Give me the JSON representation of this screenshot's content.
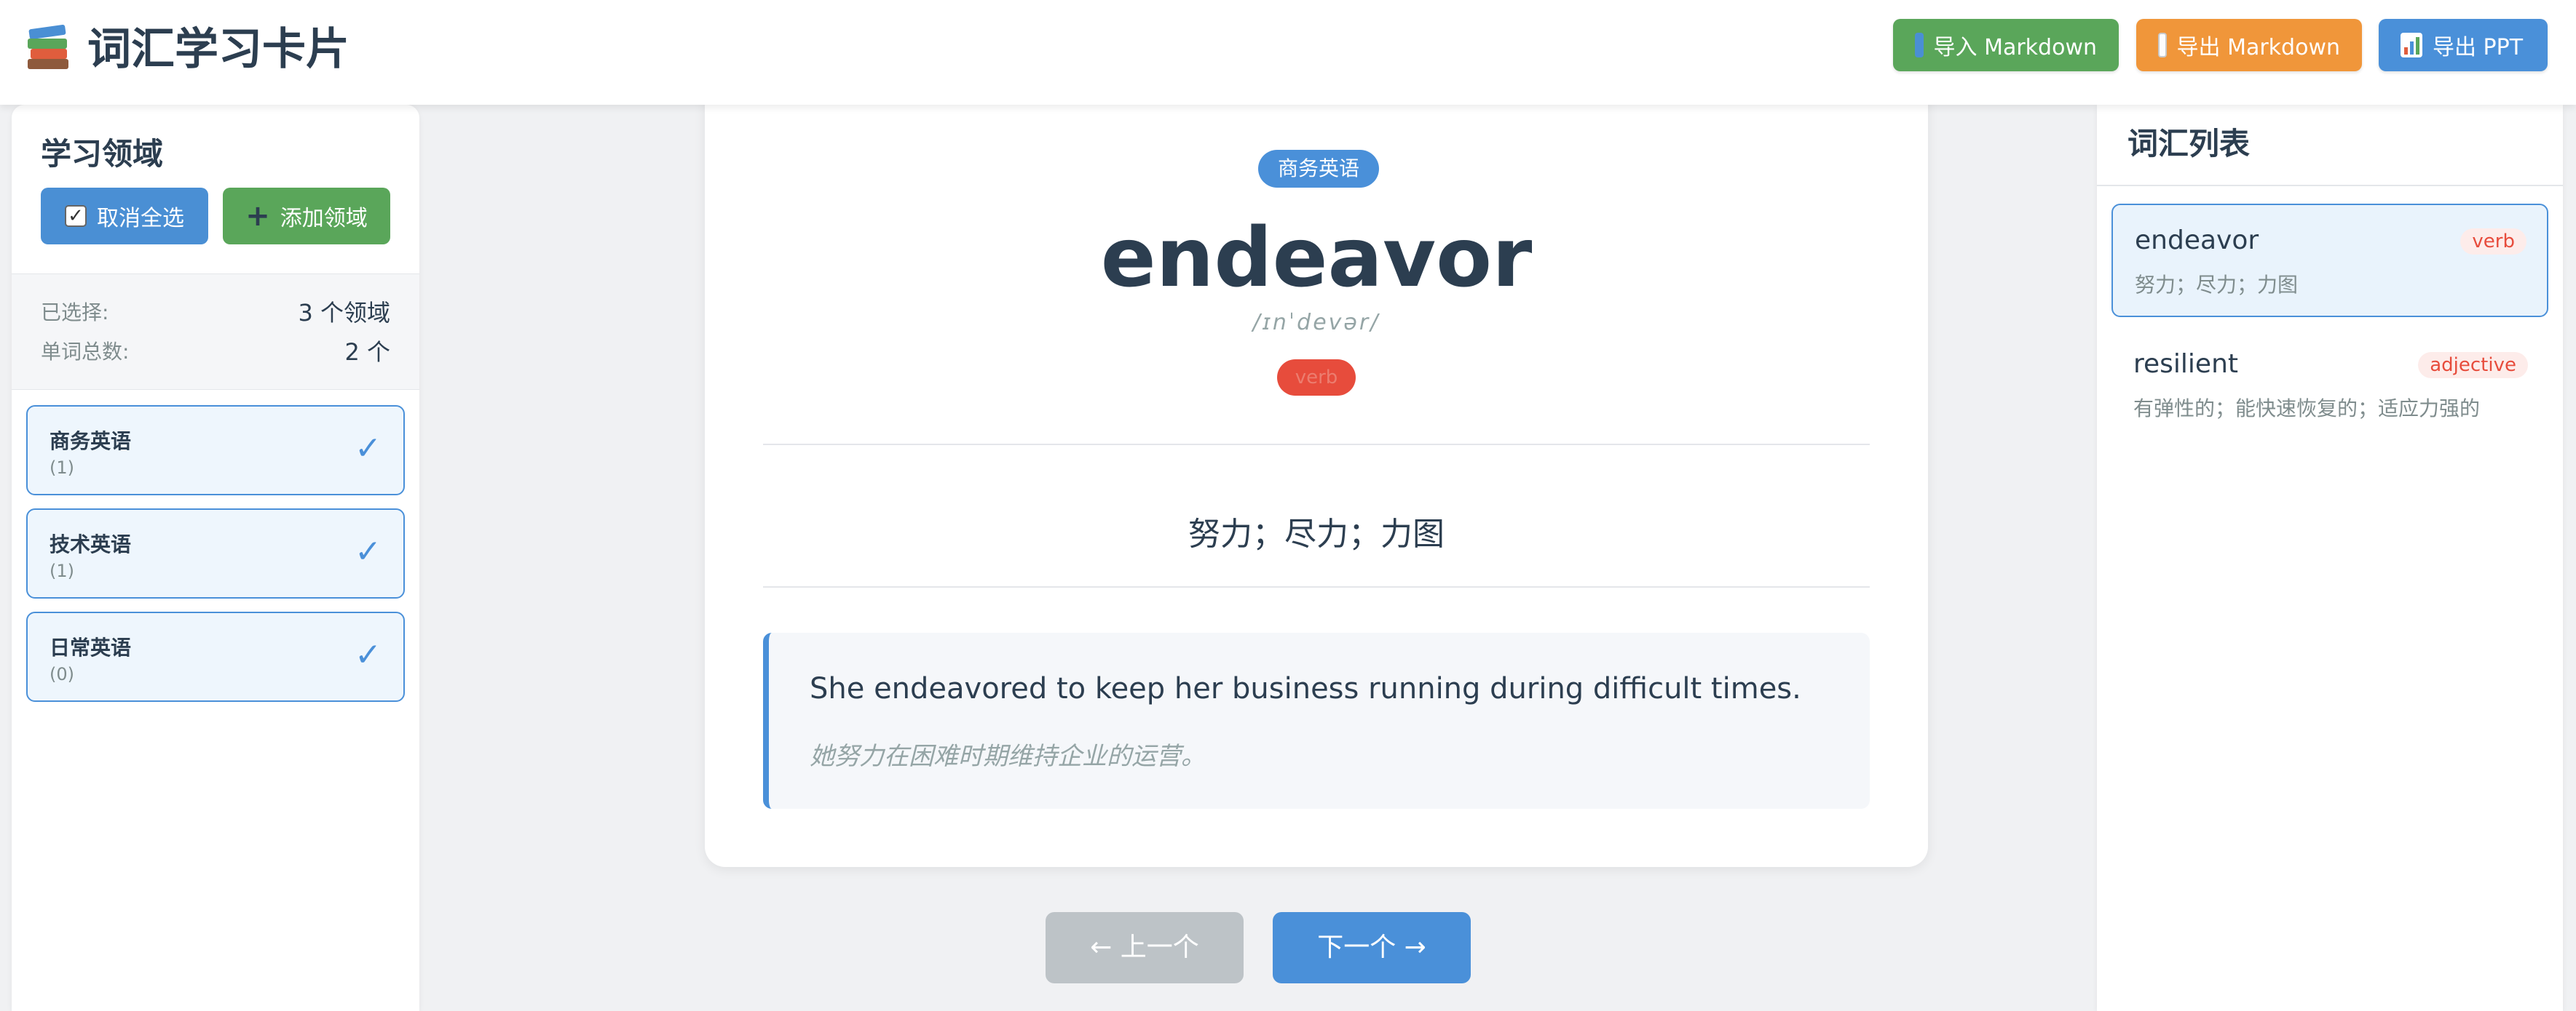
{
  "header": {
    "title": "词汇学习卡片",
    "logo_icon": "books-icon",
    "buttons": {
      "import_label": "导入 Markdown",
      "export_md_label": "导出 Markdown",
      "export_ppt_label": "导出 PPT"
    }
  },
  "sidebar": {
    "title": "学习领域",
    "deselect_label": "取消全选",
    "add_domain_label": "添加领域",
    "stats": {
      "selected_key": "已选择:",
      "selected_value": "3 个领域",
      "total_key": "单词总数:",
      "total_value": "2 个"
    },
    "domains": [
      {
        "name": "商务英语",
        "count": "(1)",
        "checked": true
      },
      {
        "name": "技术英语",
        "count": "(1)",
        "checked": true
      },
      {
        "name": "日常英语",
        "count": "(0)",
        "checked": true
      }
    ],
    "check_glyph": "✓"
  },
  "card": {
    "category": "商务英语",
    "word": "endeavor",
    "phonetic": "/ɪnˈdevər/",
    "pos": "verb",
    "meaning": "努力；尽力；力图",
    "example_en": "She endeavored to keep her business running during difficult times.",
    "example_zh": "她努力在困难时期维持企业的运营。"
  },
  "nav": {
    "prev_label": "← 上一个",
    "next_label": "下一个 →"
  },
  "vocab_list": {
    "title": "词汇列表",
    "items": [
      {
        "word": "endeavor",
        "pos": "verb",
        "meaning": "努力；尽力；力图",
        "active": true
      },
      {
        "word": "resilient",
        "pos": "adjective",
        "meaning": "有弹性的；能快速恢复的；适应力强的",
        "active": false
      }
    ]
  },
  "colors": {
    "primary": "#4a90d9",
    "success": "#5aa65a",
    "warning": "#f0963a",
    "danger": "#e74c3c",
    "muted": "#bdc3c7"
  }
}
